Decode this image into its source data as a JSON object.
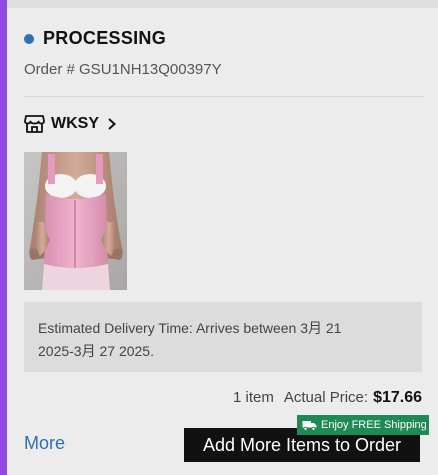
{
  "order": {
    "status": "PROCESSING",
    "status_color": "#2f6fb3",
    "order_number": "Order # GSU1NH13Q00397Y"
  },
  "store": {
    "icon": "store-icon",
    "name": "WKSY",
    "chevron_icon": "chevron-right-icon"
  },
  "product": {
    "image_name": "product-image"
  },
  "delivery": {
    "text_line1": "Estimated Delivery Time: Arrives between 3月 21",
    "text_line2": "2025-3月 27 2025."
  },
  "summary": {
    "item_count": "1 item",
    "price_label": "Actual Price:",
    "price_value": "$17.66"
  },
  "actions": {
    "more_label": "More",
    "add_more_label": "Add More Items to Order",
    "free_shipping_badge": "Enjoy FREE Shipping",
    "badge_icon": "truck-icon"
  },
  "colors": {
    "accent": "#8e4ce3",
    "link": "#2f6fb3",
    "badge": "#1f8a55",
    "button": "#111111"
  }
}
